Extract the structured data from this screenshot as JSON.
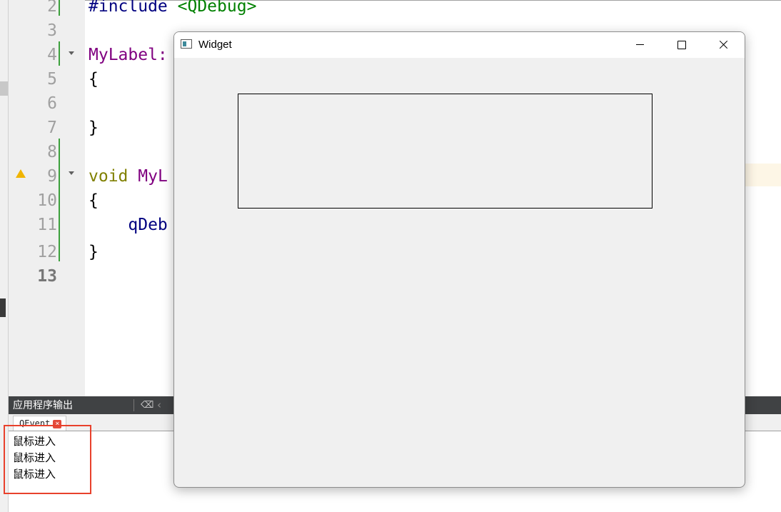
{
  "editor": {
    "line_numbers": [
      "2",
      "3",
      "4",
      "5",
      "6",
      "7",
      "8",
      "9",
      "10",
      "11",
      "12",
      "13"
    ],
    "current_line": "13",
    "code": {
      "l2_directive": "#include",
      "l2_header": "<QDebug>",
      "l4_class": "MyLabel:",
      "l5_brace": "{",
      "l7_brace": "}",
      "l9_keyword": "void",
      "l9_name": "MyL",
      "l10_brace": "{",
      "l11_call": "qDeb",
      "l12_brace": "}"
    }
  },
  "output_pane": {
    "title": "应用程序输出",
    "tab_label": "QEvent",
    "tab_close": "×",
    "lines": [
      "鼠标进入",
      "鼠标进入",
      "鼠标进入"
    ]
  },
  "widget_window": {
    "title": "Widget"
  },
  "icons": {
    "warning": "warning-icon",
    "clear": "clear-output-icon",
    "prev": "chevron-left-icon"
  },
  "colors": {
    "highlight": "#e8412c",
    "warning": "#f0b400",
    "change_bar": "#3ca03c"
  }
}
